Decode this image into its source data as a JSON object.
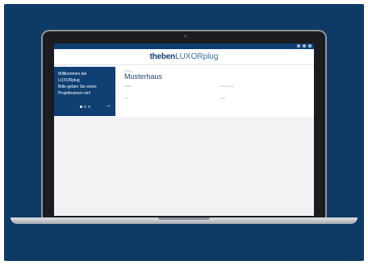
{
  "brand": {
    "strong": "theben",
    "light": "LUXORplug"
  },
  "welcome": {
    "lines": "Willkommen bei\nLUXORplug\nBitte geben Sie einen\nProjektnamen ein!",
    "arrow_icon": "arrow-right-icon"
  },
  "project": {
    "small_label": "Projekt",
    "name": "Musterhaus",
    "field_labels": [
      "Straße",
      "Hausnummer",
      "Ort",
      "Land"
    ]
  },
  "colors": {
    "frame_bg": "#0e3a66",
    "accent": "#0f3f72",
    "brand_light": "#3b6fa8"
  }
}
